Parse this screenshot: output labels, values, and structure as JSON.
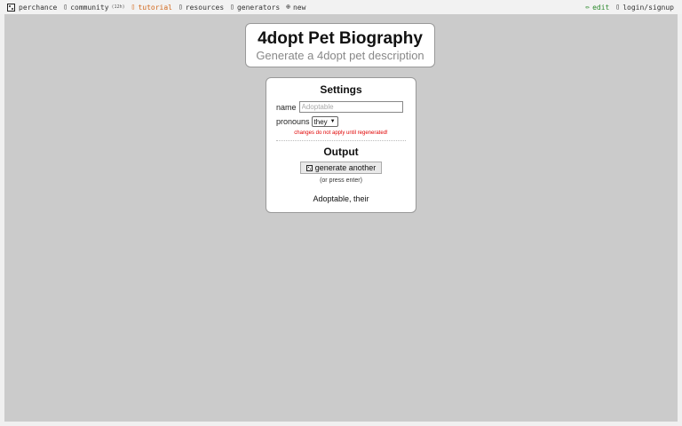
{
  "topbar": {
    "brand": "perchance",
    "community": "community",
    "community_count": "(12h)",
    "tutorial": "tutorial",
    "resources": "resources",
    "generators": "generators",
    "new": "new",
    "edit": "edit",
    "login": "login/signup",
    "colors": {
      "tutorial": "#d2691e",
      "edit": "#2e8b2e"
    }
  },
  "header": {
    "title": "4dopt Pet Biography",
    "subtitle": "Generate a 4dopt pet description"
  },
  "settings": {
    "heading": "Settings",
    "name_label": "name",
    "name_placeholder": "Adoptable",
    "name_value": "",
    "pronouns_label": "pronouns",
    "pronouns_selected": "they",
    "warning": "changes do not apply until regenerated!",
    "warning_color": "#e00000"
  },
  "output": {
    "heading": "Output",
    "button_label": "generate another",
    "hint": "(or press enter)",
    "text": "Adoptable, their"
  },
  "icons": {
    "brand": "dice-icon",
    "community": "chat-icon",
    "tutorial": "book-icon",
    "resources": "info-icon",
    "generators": "list-icon",
    "new": "plus-icon",
    "edit": "pencil-icon",
    "login": "user-icon"
  }
}
